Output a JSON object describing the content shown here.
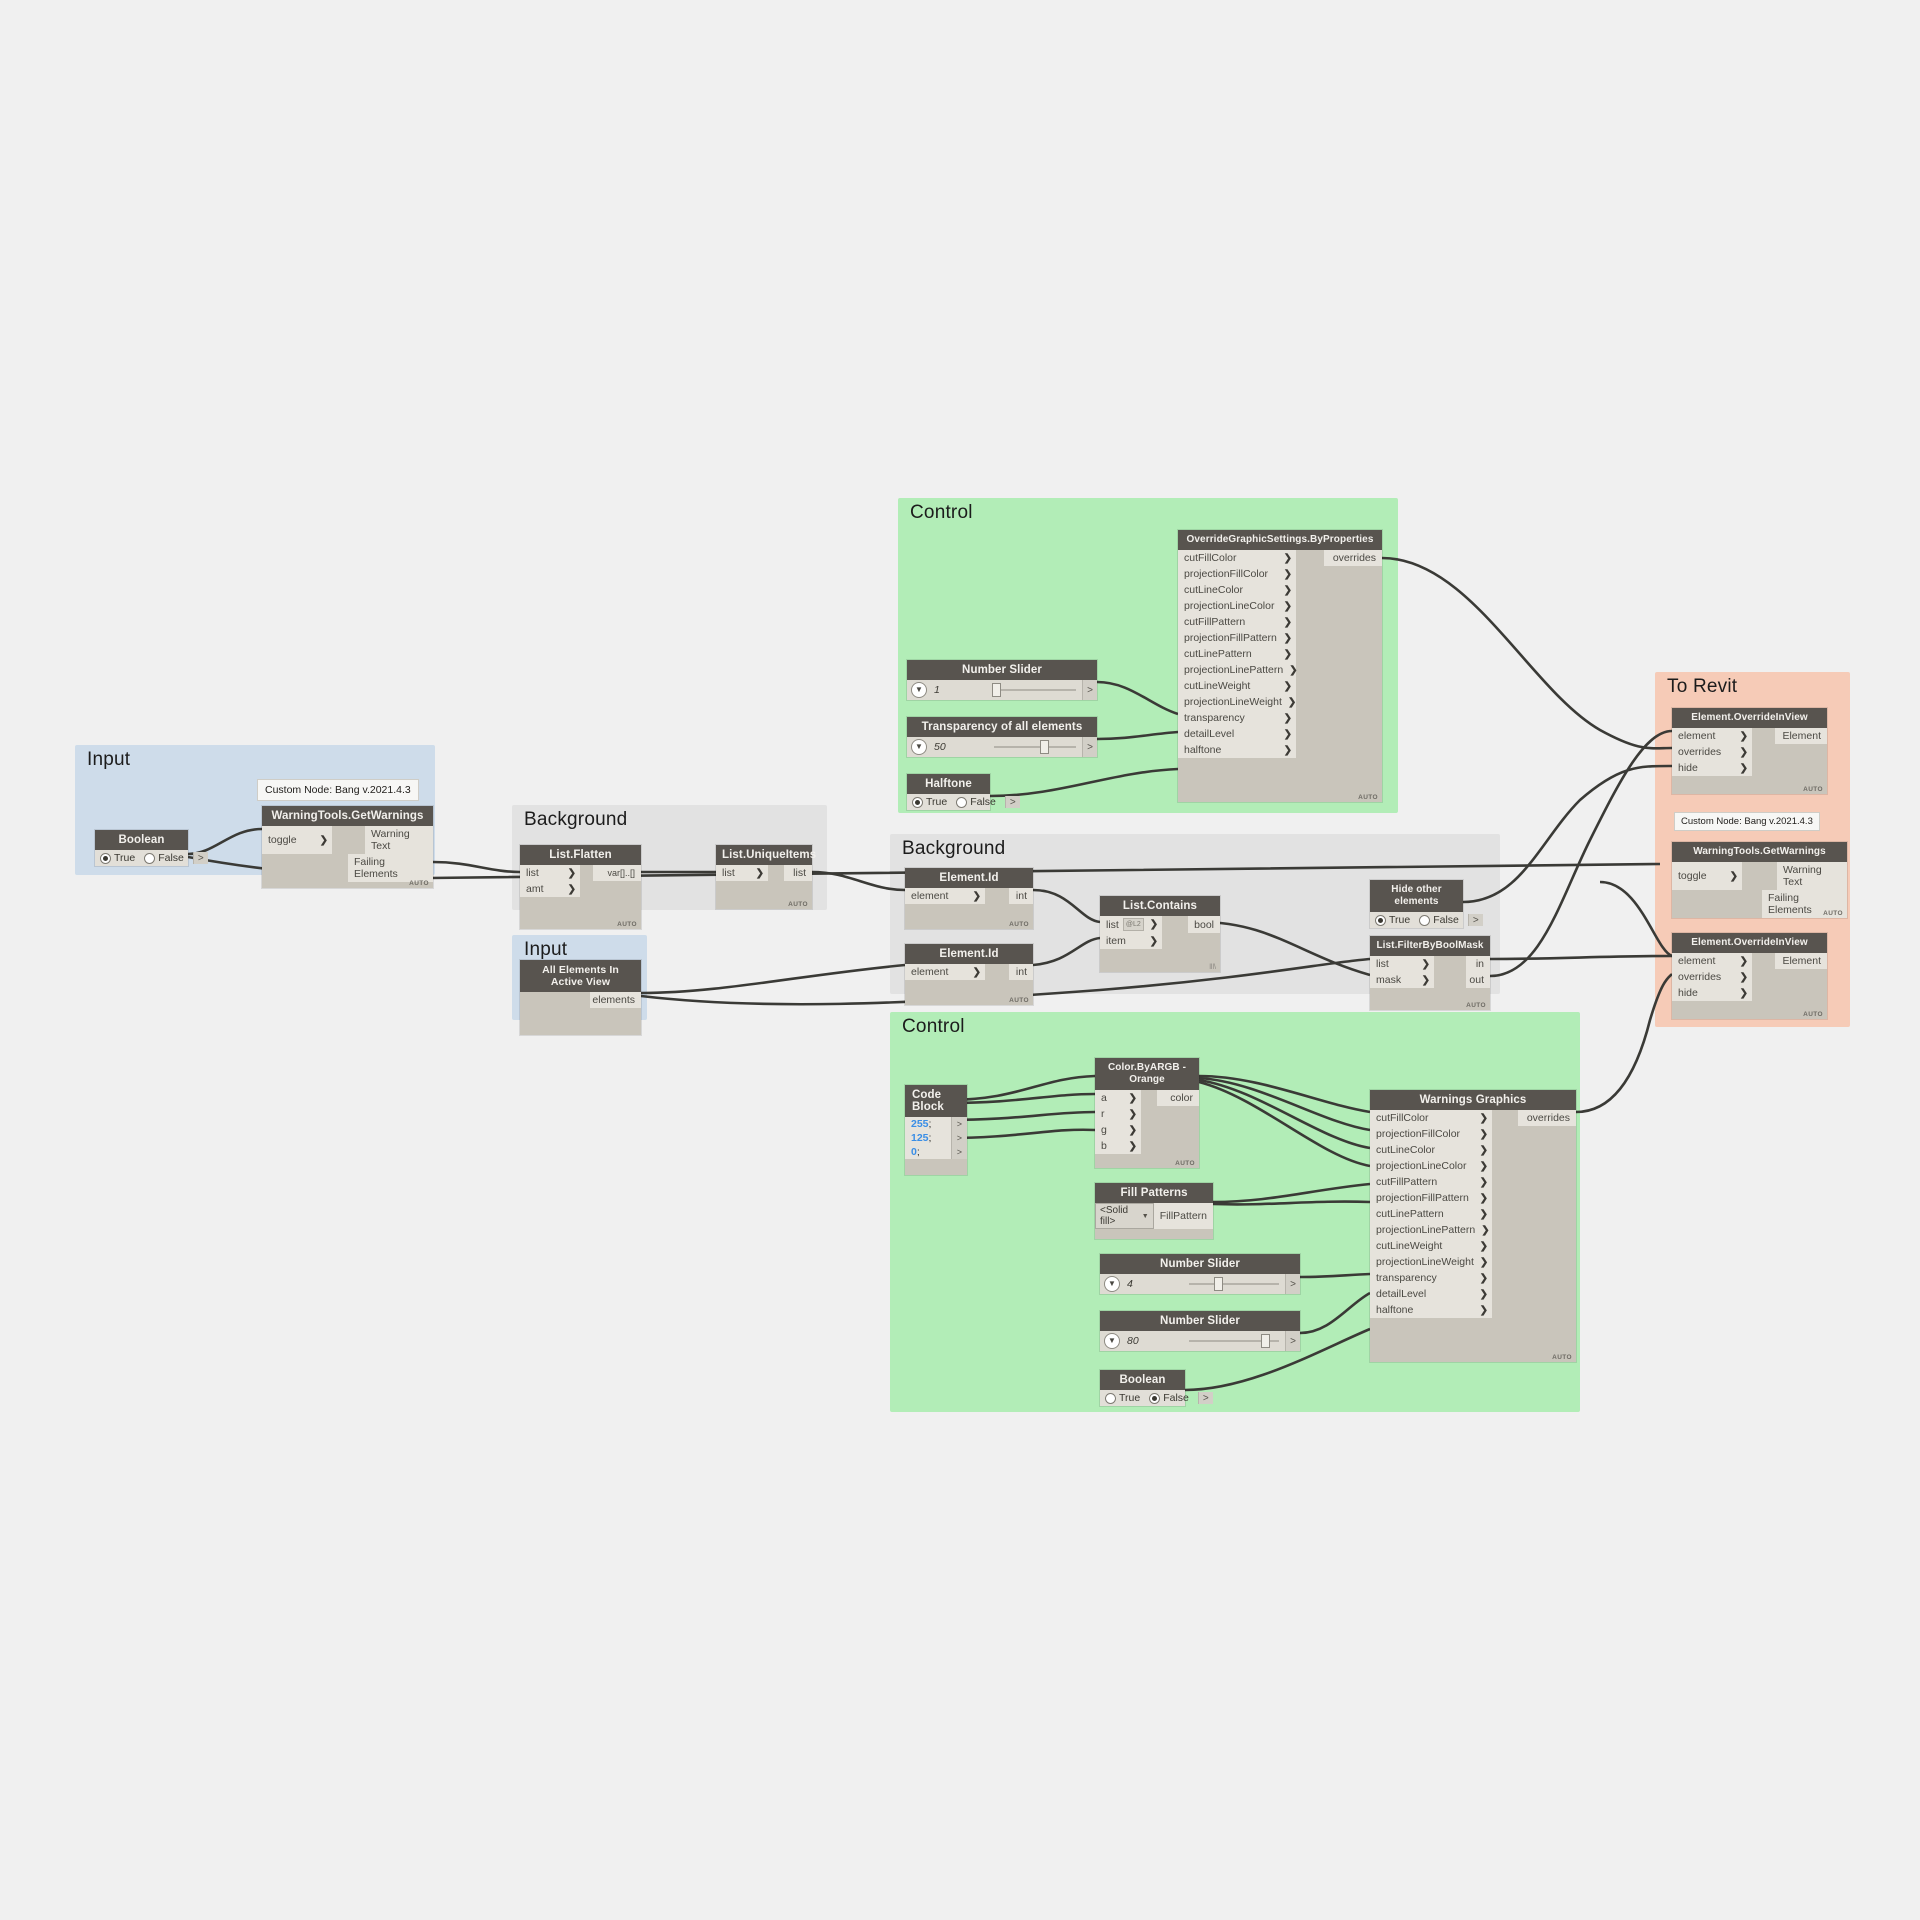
{
  "groups": [
    {
      "title": "Input"
    },
    {
      "title": "Background"
    },
    {
      "title": "Control"
    },
    {
      "title": "To Revit"
    },
    {
      "title": "Input"
    },
    {
      "title": "Background"
    },
    {
      "title": "Control"
    }
  ],
  "notes": [
    {
      "text": "Custom Node: Bang v.2021.4.3"
    },
    {
      "text": "Custom Node: Bang v.2021.4.3"
    }
  ],
  "nodes": {
    "boolean_input": {
      "title": "Boolean",
      "true_label": "True",
      "false_label": "False",
      "value": "True",
      "port": ">"
    },
    "warningtools_1": {
      "title": "WarningTools.GetWarnings",
      "inputs": [
        "toggle"
      ],
      "outputs": [
        "Warning Text",
        "Failing Elements"
      ],
      "auto": "AUTO"
    },
    "all_elements": {
      "title": "All Elements In Active View",
      "outputs": [
        "elements"
      ]
    },
    "list_flatten": {
      "title": "List.Flatten",
      "inputs": [
        "list",
        "amt"
      ],
      "outputs": [
        "var[]..[]"
      ],
      "auto": "AUTO"
    },
    "list_uniqueitems": {
      "title": "List.UniqueItems",
      "inputs": [
        "list"
      ],
      "outputs": [
        "list"
      ],
      "auto": "AUTO"
    },
    "element_id_1": {
      "title": "Element.Id",
      "inputs": [
        "element"
      ],
      "outputs": [
        "int"
      ],
      "auto": "AUTO"
    },
    "element_id_2": {
      "title": "Element.Id",
      "inputs": [
        "element"
      ],
      "outputs": [
        "int"
      ],
      "auto": "AUTO"
    },
    "list_contains": {
      "title": "List.Contains",
      "inputs": [
        "list",
        "item"
      ],
      "list_lacing": "@L2",
      "outputs": [
        "bool"
      ],
      "lacing_mark": "lll\\"
    },
    "hide_other_elements": {
      "title": "Hide other elements",
      "true_label": "True",
      "false_label": "False",
      "value": "True",
      "port": ">"
    },
    "list_filterbyboolmask": {
      "title": "List.FilterByBoolMask",
      "inputs": [
        "list",
        "mask"
      ],
      "outputs": [
        "in",
        "out"
      ],
      "auto": "AUTO"
    },
    "number_slider_1": {
      "title": "Number Slider",
      "value": "1",
      "knob_pct": 2,
      "port": ">"
    },
    "transparency_slider": {
      "title": "Transparency of all elements",
      "value": "50",
      "knob_pct": 55,
      "port": ">"
    },
    "halftone_bool": {
      "title": "Halftone",
      "true_label": "True",
      "false_label": "False",
      "value": "True",
      "port": ">"
    },
    "override_graphic_settings": {
      "title": "OverrideGraphicSettings.ByProperties",
      "inputs": [
        "cutFillColor",
        "projectionFillColor",
        "cutLineColor",
        "projectionLineColor",
        "cutFillPattern",
        "projectionFillPattern",
        "cutLinePattern",
        "projectionLinePattern",
        "cutLineWeight",
        "projectionLineWeight",
        "transparency",
        "detailLevel",
        "halftone"
      ],
      "outputs": [
        "overrides"
      ],
      "auto": "AUTO"
    },
    "element_override_1": {
      "title": "Element.OverrideInView",
      "inputs": [
        "element",
        "overrides",
        "hide"
      ],
      "outputs": [
        "Element"
      ],
      "auto": "AUTO"
    },
    "warningtools_2": {
      "title": "WarningTools.GetWarnings",
      "inputs": [
        "toggle"
      ],
      "outputs": [
        "Warning Text",
        "Failing Elements"
      ],
      "auto": "AUTO"
    },
    "element_override_2": {
      "title": "Element.OverrideInView",
      "inputs": [
        "element",
        "overrides",
        "hide"
      ],
      "outputs": [
        "Element"
      ],
      "auto": "AUTO"
    },
    "code_block": {
      "title": "Code Block",
      "lines": [
        "255",
        "125",
        "0"
      ],
      "semicolon": ";",
      "port": ">"
    },
    "color_byargb": {
      "title": "Color.ByARGB - Orange",
      "inputs": [
        "a",
        "r",
        "g",
        "b"
      ],
      "outputs": [
        "color"
      ],
      "auto": "AUTO"
    },
    "fill_patterns": {
      "title": "Fill Patterns",
      "selected": "<Solid fill>",
      "outputs": [
        "FillPattern"
      ]
    },
    "number_slider_2": {
      "title": "Number Slider",
      "value": "4",
      "knob_pct": 30,
      "port": ">"
    },
    "number_slider_3": {
      "title": "Number Slider",
      "value": "80",
      "knob_pct": 76,
      "port": ">"
    },
    "boolean_bottom": {
      "title": "Boolean",
      "true_label": "True",
      "false_label": "False",
      "value": "False",
      "port": ">"
    },
    "warnings_graphics": {
      "title": "Warnings Graphics",
      "inputs": [
        "cutFillColor",
        "projectionFillColor",
        "cutLineColor",
        "projectionLineColor",
        "cutFillPattern",
        "projectionFillPattern",
        "cutLinePattern",
        "projectionLinePattern",
        "cutLineWeight",
        "projectionLineWeight",
        "transparency",
        "detailLevel",
        "halftone"
      ],
      "outputs": [
        "overrides"
      ],
      "auto": "AUTO"
    }
  },
  "colors": {
    "canvas": "#f0f0f0",
    "group_input": "#cedcea",
    "group_background": "#e2e2e2",
    "group_control": "#b2edb7",
    "group_torevit": "#f6cbb7",
    "node_header": "#58544f",
    "node_body": "#c9c5bb",
    "port": "#e6e3dc",
    "wire": "#3a3a36",
    "codeblock_number": "#3a8ee6"
  }
}
